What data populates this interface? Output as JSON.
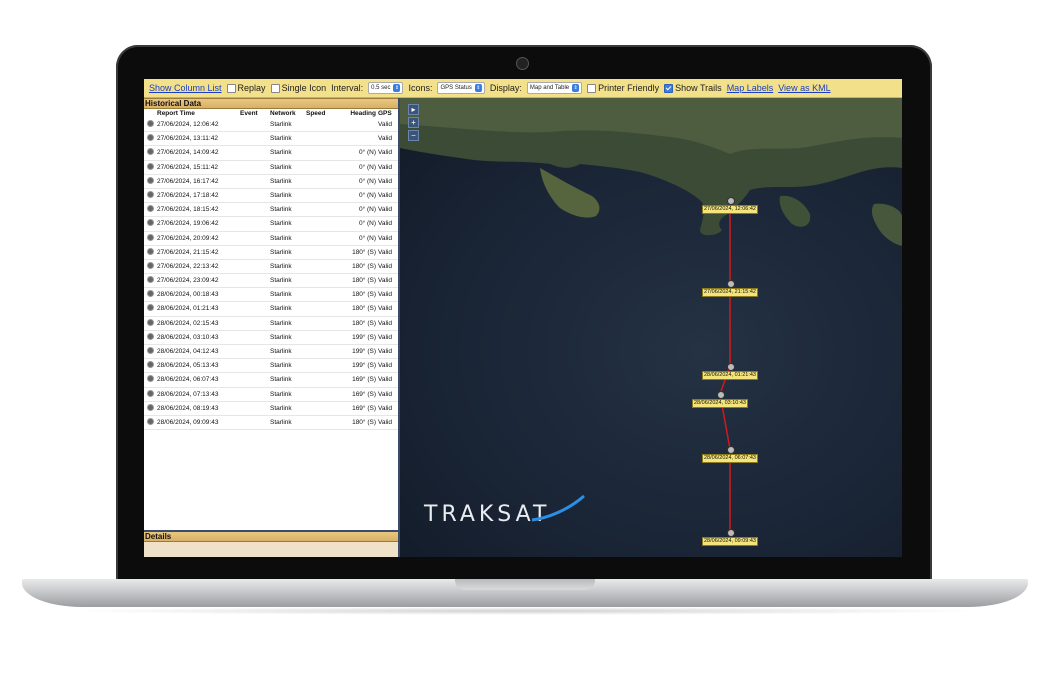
{
  "toolbar": {
    "show_column_list": "Show Column List",
    "replay": "Replay",
    "single_icon": "Single Icon",
    "interval_label": "Interval:",
    "interval_value": "0.5 sec",
    "icons_label": "Icons:",
    "icons_value": "GPS Status",
    "display_label": "Display:",
    "display_value": "Map and Table",
    "printer_friendly": "Printer Friendly",
    "show_trails": "Show Trails",
    "show_trails_checked": true,
    "map_labels": "Map Labels",
    "view_as_kml": "View as KML"
  },
  "historical": {
    "title": "Historical Data",
    "columns": [
      "Report Time",
      "Event",
      "Network",
      "Speed",
      "Heading",
      "GPS"
    ],
    "rows": [
      {
        "time": "27/06/2024, 12:06:42",
        "event": "",
        "network": "Starlink",
        "speed": "",
        "heading": "",
        "gps": "Valid"
      },
      {
        "time": "27/06/2024, 13:11:42",
        "event": "",
        "network": "Starlink",
        "speed": "",
        "heading": "",
        "gps": "Valid"
      },
      {
        "time": "27/06/2024, 14:09:42",
        "event": "",
        "network": "Starlink",
        "speed": "",
        "heading": "0° (N)",
        "gps": "Valid"
      },
      {
        "time": "27/06/2024, 15:11:42",
        "event": "",
        "network": "Starlink",
        "speed": "",
        "heading": "0° (N)",
        "gps": "Valid"
      },
      {
        "time": "27/06/2024, 16:17:42",
        "event": "",
        "network": "Starlink",
        "speed": "",
        "heading": "0° (N)",
        "gps": "Valid"
      },
      {
        "time": "27/06/2024, 17:18:42",
        "event": "",
        "network": "Starlink",
        "speed": "",
        "heading": "0° (N)",
        "gps": "Valid"
      },
      {
        "time": "27/06/2024, 18:15:42",
        "event": "",
        "network": "Starlink",
        "speed": "",
        "heading": "0° (N)",
        "gps": "Valid"
      },
      {
        "time": "27/06/2024, 19:06:42",
        "event": "",
        "network": "Starlink",
        "speed": "",
        "heading": "0° (N)",
        "gps": "Valid"
      },
      {
        "time": "27/06/2024, 20:09:42",
        "event": "",
        "network": "Starlink",
        "speed": "",
        "heading": "0° (N)",
        "gps": "Valid"
      },
      {
        "time": "27/06/2024, 21:15:42",
        "event": "",
        "network": "Starlink",
        "speed": "",
        "heading": "180° (S)",
        "gps": "Valid"
      },
      {
        "time": "27/06/2024, 22:13:42",
        "event": "",
        "network": "Starlink",
        "speed": "",
        "heading": "180° (S)",
        "gps": "Valid"
      },
      {
        "time": "27/06/2024, 23:09:42",
        "event": "",
        "network": "Starlink",
        "speed": "",
        "heading": "180° (S)",
        "gps": "Valid"
      },
      {
        "time": "28/06/2024, 00:18:43",
        "event": "",
        "network": "Starlink",
        "speed": "",
        "heading": "180° (S)",
        "gps": "Valid"
      },
      {
        "time": "28/06/2024, 01:21:43",
        "event": "",
        "network": "Starlink",
        "speed": "",
        "heading": "180° (S)",
        "gps": "Valid"
      },
      {
        "time": "28/06/2024, 02:15:43",
        "event": "",
        "network": "Starlink",
        "speed": "",
        "heading": "180° (S)",
        "gps": "Valid"
      },
      {
        "time": "28/06/2024, 03:10:43",
        "event": "",
        "network": "Starlink",
        "speed": "",
        "heading": "199° (S)",
        "gps": "Valid"
      },
      {
        "time": "28/06/2024, 04:12:43",
        "event": "",
        "network": "Starlink",
        "speed": "",
        "heading": "199° (S)",
        "gps": "Valid"
      },
      {
        "time": "28/06/2024, 05:13:43",
        "event": "",
        "network": "Starlink",
        "speed": "",
        "heading": "199° (S)",
        "gps": "Valid"
      },
      {
        "time": "28/06/2024, 06:07:43",
        "event": "",
        "network": "Starlink",
        "speed": "",
        "heading": "169° (S)",
        "gps": "Valid"
      },
      {
        "time": "28/06/2024, 07:13:43",
        "event": "",
        "network": "Starlink",
        "speed": "",
        "heading": "169° (S)",
        "gps": "Valid"
      },
      {
        "time": "28/06/2024, 08:19:43",
        "event": "",
        "network": "Starlink",
        "speed": "",
        "heading": "169° (S)",
        "gps": "Valid"
      },
      {
        "time": "28/06/2024, 09:09:43",
        "event": "",
        "network": "Starlink",
        "speed": "",
        "heading": "180° (S)",
        "gps": "Valid"
      }
    ]
  },
  "details": {
    "title": "Details"
  },
  "map": {
    "zoom_in": "+",
    "zoom_out": "−",
    "logo": "TRAKSAT",
    "track_color": "#d11a1a",
    "track_labels": [
      "27/06/2024, 12:06:42",
      "27/06/2024, 21:15:42",
      "28/06/2024, 01:21:43",
      "28/06/2024, 03:10:43",
      "28/06/2024, 06:07:43",
      "28/06/2024, 09:09:43"
    ]
  },
  "icons": {
    "expand": "arrow-right-icon",
    "row_marker": "gps-status-icon",
    "select_arrow": "chevron-updown-icon"
  }
}
